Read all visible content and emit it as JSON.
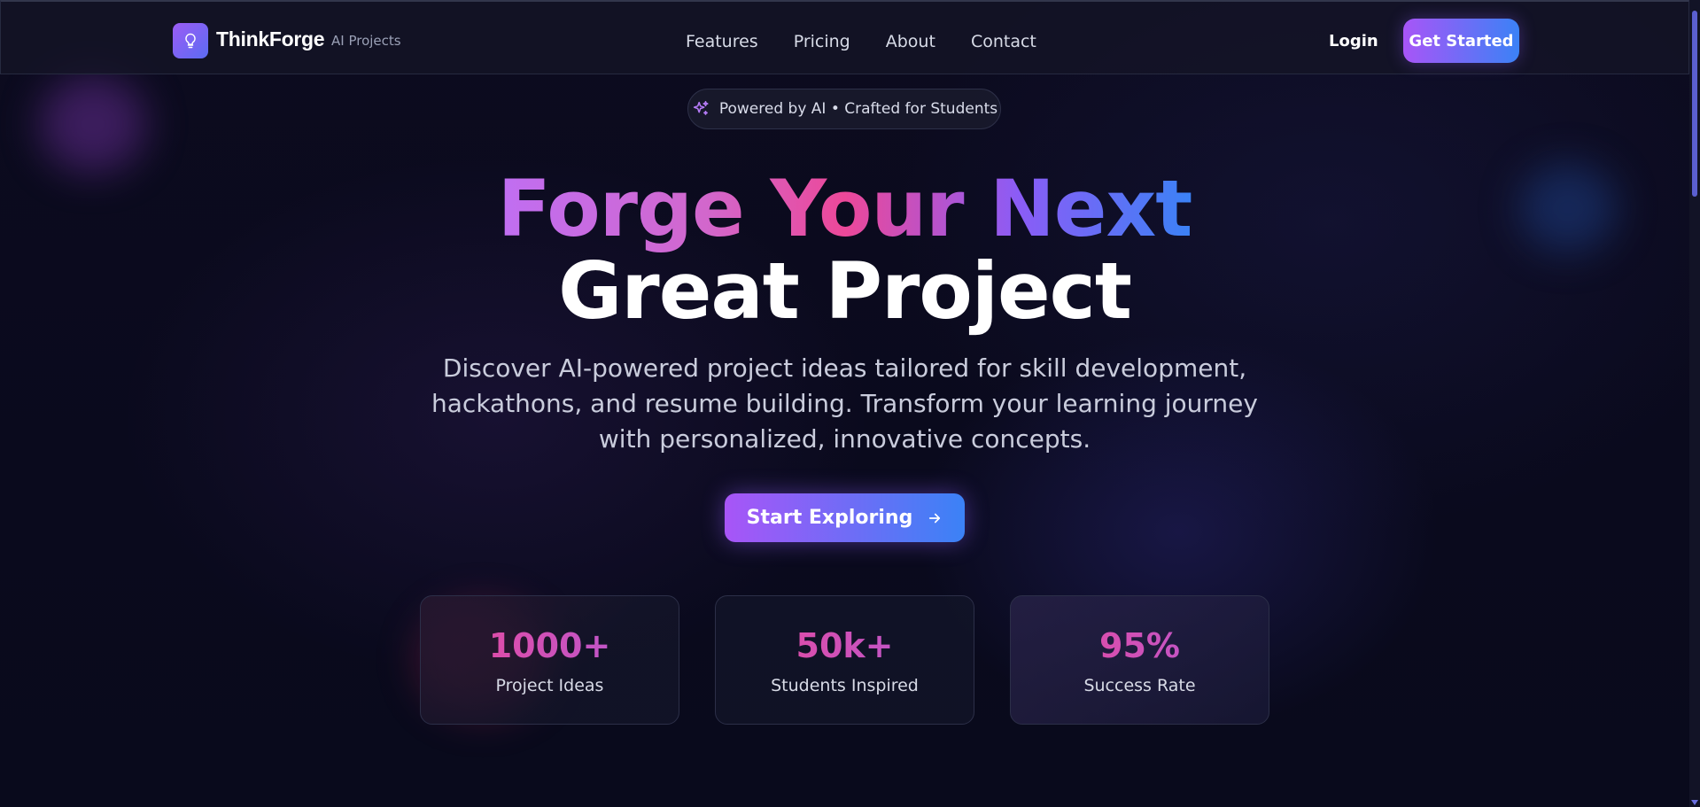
{
  "brand": {
    "name": "ThinkForge",
    "sub": "AI Projects",
    "icon": "lightbulb-icon"
  },
  "nav": {
    "links": [
      "Features",
      "Pricing",
      "About",
      "Contact"
    ],
    "login": "Login",
    "get_started": "Get Started"
  },
  "badge": {
    "icon": "sparkles-icon",
    "text": "Powered by AI • Crafted for Students"
  },
  "hero": {
    "line1": "Forge Your Next",
    "line2": "Great Project",
    "subtitle": "Discover AI-powered project ideas tailored for skill development, hackathons, and resume building. Transform your learning journey with personalized, innovative concepts.",
    "cta": "Start Exploring",
    "cta_icon": "arrow-right-icon"
  },
  "stats": [
    {
      "value": "1000+",
      "label": "Project Ideas"
    },
    {
      "value": "50k+",
      "label": "Students Inspired"
    },
    {
      "value": "95%",
      "label": "Success Rate"
    }
  ],
  "colors": {
    "background": "#0b0a1c",
    "accent_purple": "#a855f7",
    "accent_blue": "#3b82f6",
    "accent_pink": "#ec4899"
  }
}
